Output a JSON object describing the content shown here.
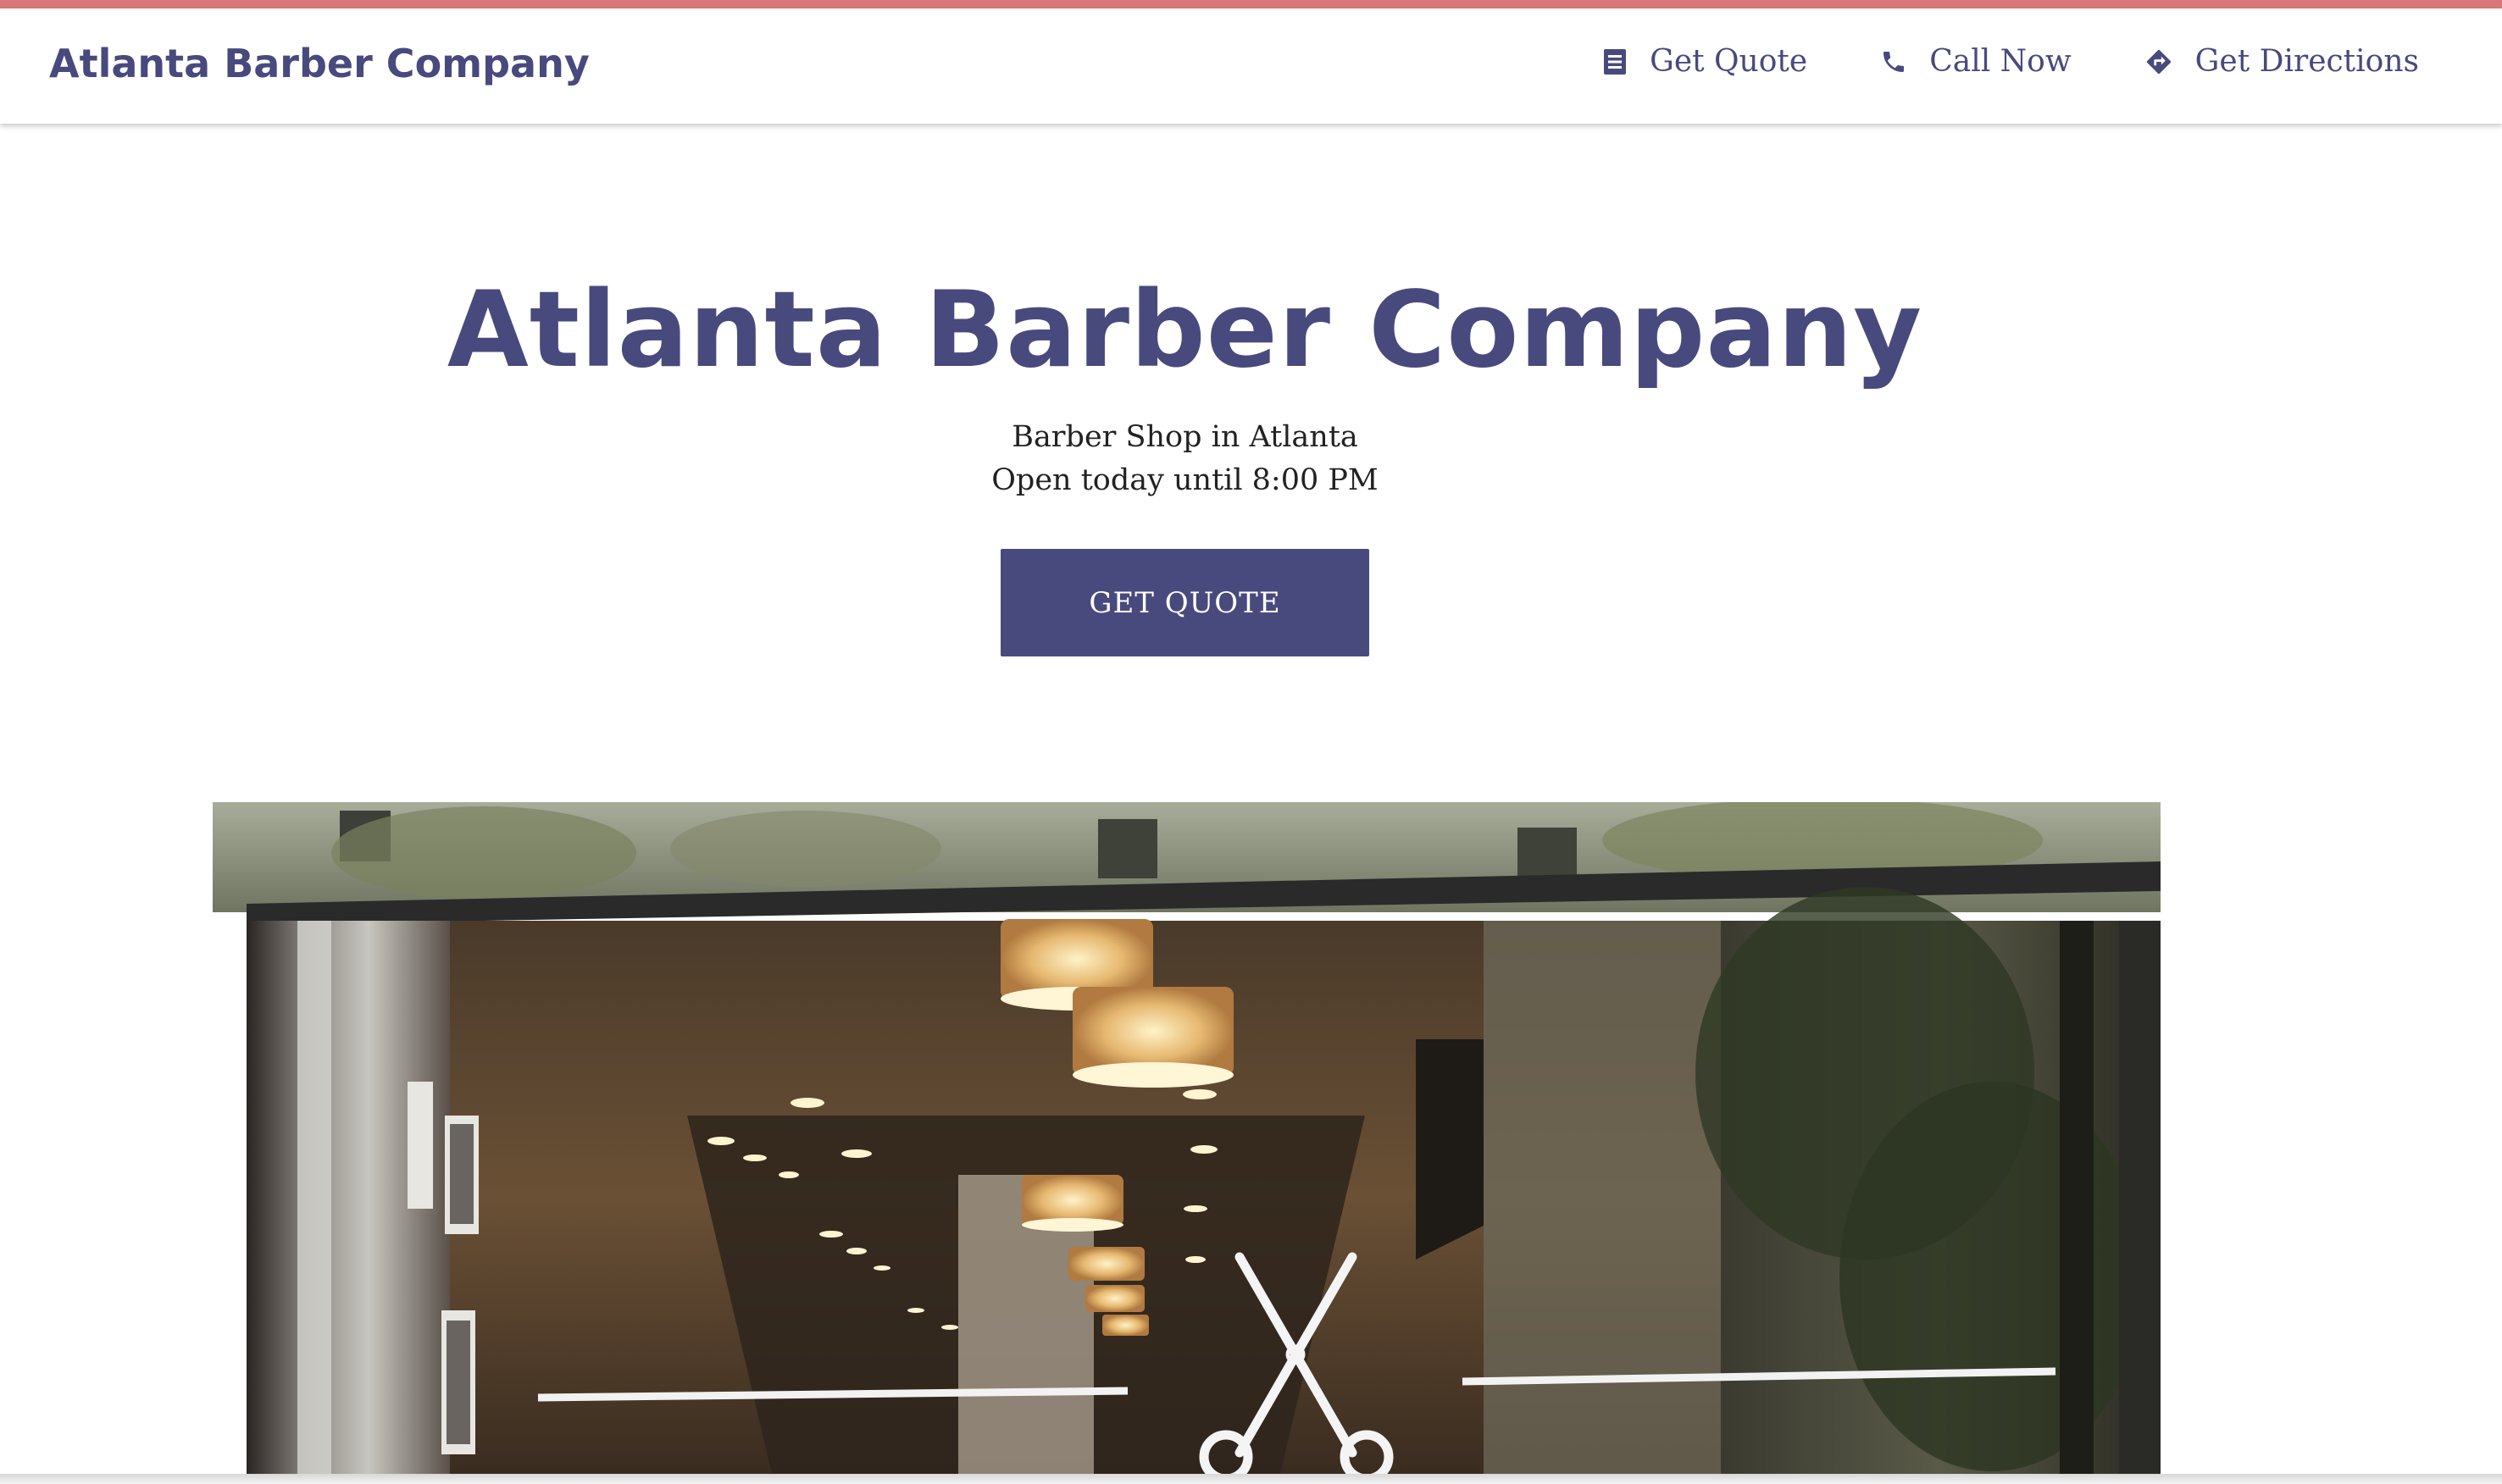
{
  "colors": {
    "accent_bar": "#d9767a",
    "brand": "#484a7e",
    "button_bg": "#484a7e",
    "button_text": "#ffffff",
    "body_text": "#222222"
  },
  "navbar": {
    "brand": "Atlanta Barber Company",
    "links": [
      {
        "label": "Get Quote",
        "icon": "document-icon"
      },
      {
        "label": "Call Now",
        "icon": "phone-icon"
      },
      {
        "label": "Get Directions",
        "icon": "directions-icon"
      }
    ]
  },
  "hero": {
    "title": "Atlanta Barber Company",
    "category": "Barber Shop in Atlanta",
    "hours": "Open today until 8:00 PM",
    "cta_label": "GET QUOTE"
  },
  "storefront_image": {
    "icon": "scissors-icon"
  }
}
